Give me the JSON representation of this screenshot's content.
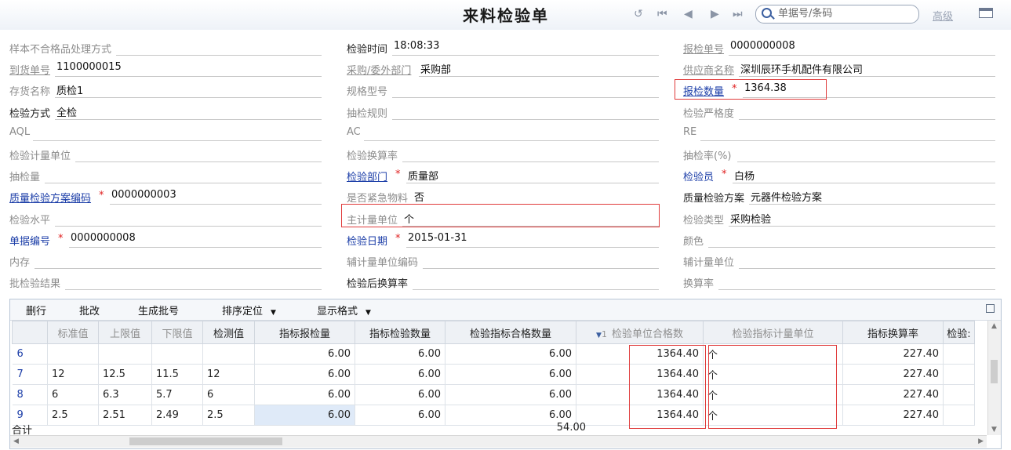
{
  "header": {
    "title": "来料检验单",
    "search_placeholder": "单据号/条码",
    "advanced_label": "高级",
    "nav_icons": [
      "refresh-icon",
      "first-icon",
      "prev-icon",
      "next-icon",
      "last-icon"
    ]
  },
  "form": {
    "col1": [
      {
        "label": "样本不合格品处理方式",
        "value": "",
        "style": "plain",
        "req": false
      },
      {
        "label": "到货单号",
        "value": "1100000015",
        "style": "plain-link",
        "req": false
      },
      {
        "label": "存货名称",
        "value": "质检1",
        "style": "plain",
        "req": false
      },
      {
        "label": "检验方式",
        "value": "全检",
        "style": "dark",
        "req": false
      },
      {
        "label": "AQL",
        "value": "",
        "style": "plain",
        "req": false
      },
      {
        "label": "检验计量单位",
        "value": "",
        "style": "plain",
        "req": false
      },
      {
        "label": "抽检量",
        "value": "",
        "style": "plain",
        "req": false
      },
      {
        "label": "质量检验方案编码",
        "value": "0000000003",
        "style": "link",
        "req": true
      },
      {
        "label": "检验水平",
        "value": "",
        "style": "plain",
        "req": false
      },
      {
        "label": "单据编号",
        "value": "0000000008",
        "style": "linkb",
        "req": true
      },
      {
        "label": "内存",
        "value": "",
        "style": "plain",
        "req": false
      },
      {
        "label": "批检验结果",
        "value": "",
        "style": "plain",
        "req": false
      }
    ],
    "col2": [
      {
        "label": "检验时间",
        "value": "18:08:33",
        "style": "dark",
        "req": false
      },
      {
        "label": "采购/委外部门",
        "value": "采购部",
        "style": "plain-link",
        "req": false
      },
      {
        "label": "规格型号",
        "value": "",
        "style": "plain",
        "req": false
      },
      {
        "label": "抽检规则",
        "value": "",
        "style": "plain",
        "req": false
      },
      {
        "label": "AC",
        "value": "",
        "style": "plain",
        "req": false
      },
      {
        "label": "检验换算率",
        "value": "",
        "style": "plain",
        "req": false
      },
      {
        "label": "检验部门",
        "value": "质量部",
        "style": "link",
        "req": true
      },
      {
        "label": "是否紧急物料",
        "value": "否",
        "style": "plain",
        "req": false
      },
      {
        "label": "主计量单位",
        "value": "个",
        "style": "plain",
        "req": false
      },
      {
        "label": "检验日期",
        "value": "2015-01-31",
        "style": "linkb",
        "req": true
      },
      {
        "label": "辅计量单位编码",
        "value": "",
        "style": "plain",
        "req": false
      },
      {
        "label": "检验后换算率",
        "value": "",
        "style": "dark",
        "req": false
      }
    ],
    "col3": [
      {
        "label": "报检单号",
        "value": "0000000008",
        "style": "plain-link",
        "req": false
      },
      {
        "label": "供应商名称",
        "value": "深圳辰环手机配件有限公司",
        "style": "plain-link",
        "req": false
      },
      {
        "label": "报检数量",
        "value": "1364.38",
        "style": "link",
        "req": true
      },
      {
        "label": "检验严格度",
        "value": "",
        "style": "plain",
        "req": false
      },
      {
        "label": "RE",
        "value": "",
        "style": "plain",
        "req": false
      },
      {
        "label": "抽检率(%)",
        "value": "",
        "style": "plain",
        "req": false
      },
      {
        "label": "检验员",
        "value": "白杨",
        "style": "linkb",
        "req": true
      },
      {
        "label": "质量检验方案",
        "value": "元器件检验方案",
        "style": "dark",
        "req": false
      },
      {
        "label": "检验类型",
        "value": "采购检验",
        "style": "plain",
        "req": false
      },
      {
        "label": "颜色",
        "value": "",
        "style": "plain",
        "req": false
      },
      {
        "label": "辅计量单位",
        "value": "",
        "style": "plain",
        "req": false
      },
      {
        "label": "换算率",
        "value": "",
        "style": "plain",
        "req": false
      }
    ]
  },
  "toolbar": {
    "buttons": [
      "删行",
      "批改",
      "生成批号",
      "排序定位",
      "显示格式"
    ]
  },
  "grid": {
    "columns": [
      "",
      "标准值",
      "上限值",
      "下限值",
      "检测值",
      "指标报检量",
      "指标检验数量",
      "检验指标合格数量",
      "检验单位合格数",
      "检验指标计量单位",
      "指标换算率",
      "检验:"
    ],
    "rows": [
      [
        "6",
        "",
        "",
        "",
        "",
        "6.00",
        "6.00",
        "6.00",
        "1364.40",
        "个",
        "227.40",
        ""
      ],
      [
        "7",
        "12",
        "12.5",
        "11.5",
        "12",
        "6.00",
        "6.00",
        "6.00",
        "1364.40",
        "个",
        "227.40",
        ""
      ],
      [
        "8",
        "6",
        "6.3",
        "5.7",
        "6",
        "6.00",
        "6.00",
        "6.00",
        "1364.40",
        "个",
        "227.40",
        ""
      ],
      [
        "9",
        "2.5",
        "2.51",
        "2.49",
        "2.5",
        "6.00",
        "6.00",
        "6.00",
        "1364.40",
        "个",
        "227.40",
        ""
      ]
    ],
    "sort_indicator": "1",
    "total_label": "合计",
    "total_value": "54.00"
  }
}
